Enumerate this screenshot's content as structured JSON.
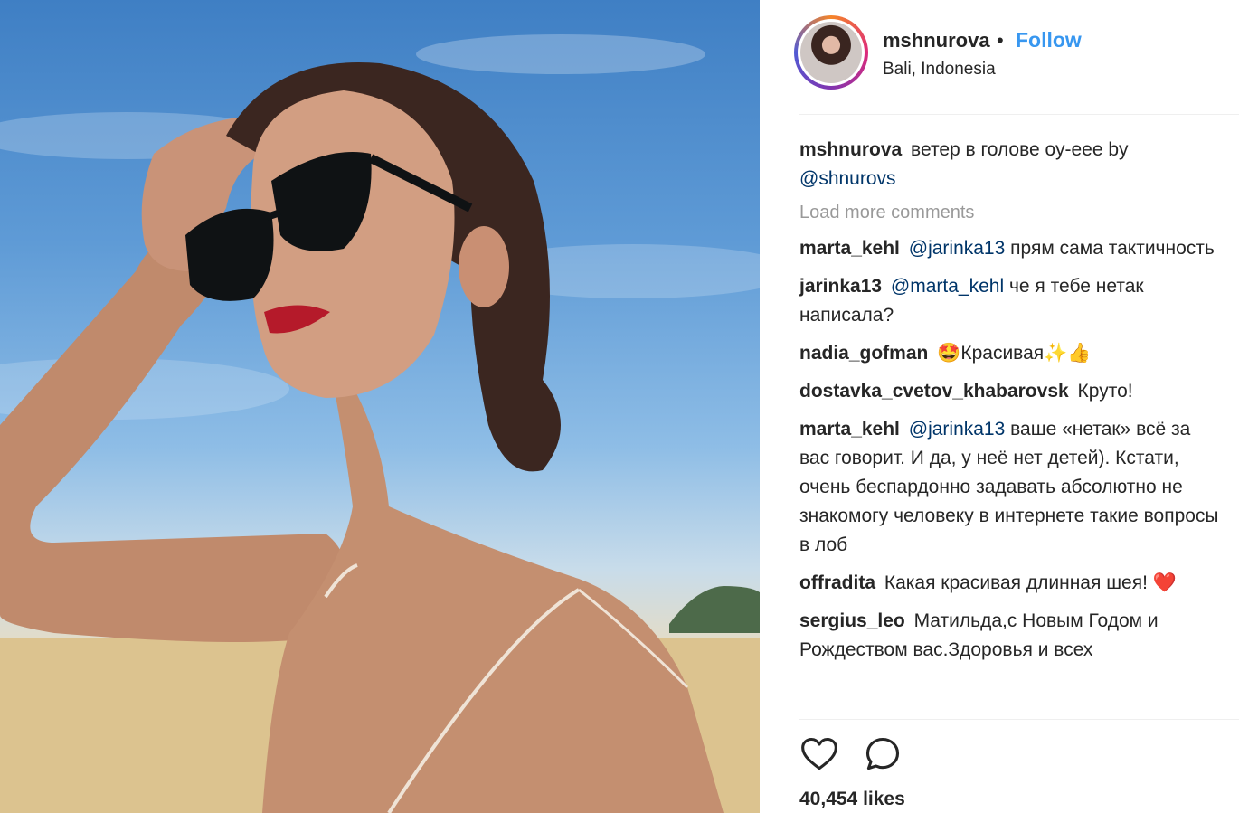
{
  "post": {
    "username": "mshnurova",
    "separator": "•",
    "follow_label": "Follow",
    "location": "Bali, Indonesia"
  },
  "caption": {
    "username": "mshnurova",
    "text": "ветер в голове оу-еее by",
    "mention": "@shnurovs"
  },
  "load_more": "Load more comments",
  "comments": [
    {
      "username": "marta_kehl",
      "mention": "@jarinka13",
      "text": " прям сама тактичность"
    },
    {
      "username": "jarinka13",
      "mention": "@marta_kehl",
      "text": " че я тебе нетак написала?"
    },
    {
      "username": "nadia_gofman",
      "mention": "",
      "text": "🤩Красивая✨👍"
    },
    {
      "username": "dostavka_cvetov_khabarovsk",
      "mention": "",
      "text": "Круто!"
    },
    {
      "username": "marta_kehl",
      "mention": "@jarinka13",
      "text": " ваше «нетак» всё за вас говорит. И да, у неё нет детей). Кстати, очень беспардонно задавать абсолютно не знакомогу человеку в интернете такие вопросы в лоб"
    },
    {
      "username": "offradita",
      "mention": "",
      "text": "Какая красивая длинная шея! ❤️"
    },
    {
      "username": "sergius_leo",
      "mention": "",
      "text": "Матильда,с Новым Годом и Рождеством вас.Здоровья и всех"
    }
  ],
  "likes": "40,454 likes",
  "icons": {
    "like": "heart-icon",
    "comment": "comment-icon"
  },
  "colors": {
    "follow": "#3897f0",
    "mention": "#003569",
    "text": "#262626",
    "muted": "#999999"
  }
}
